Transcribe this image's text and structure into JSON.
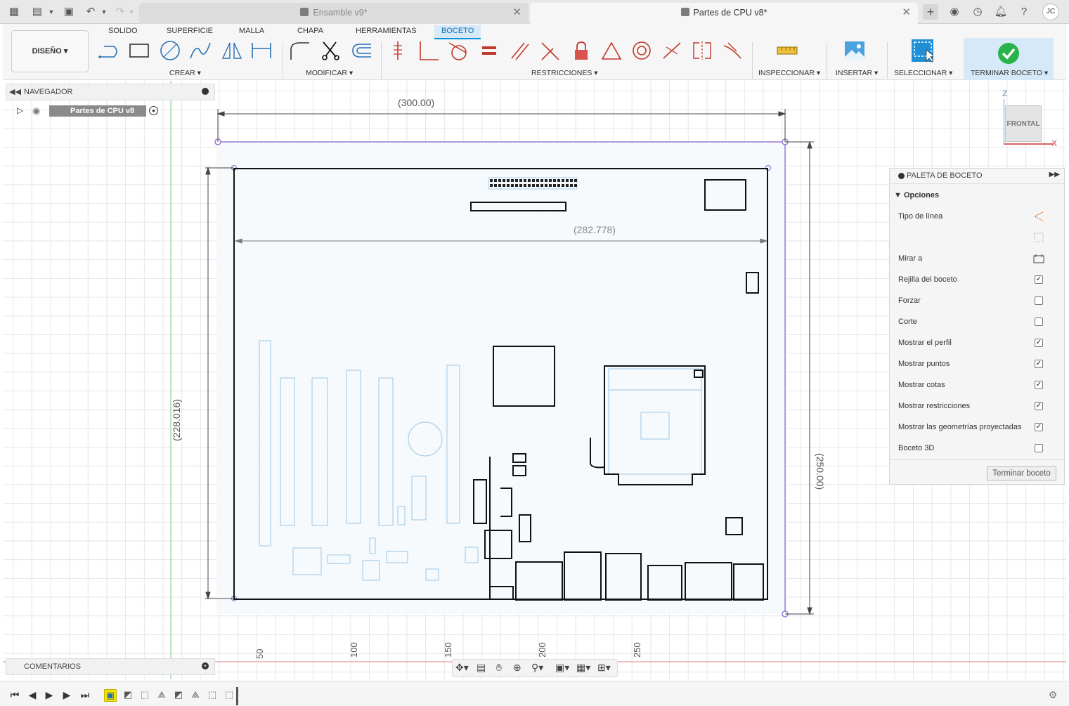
{
  "tabs": {
    "inactive": "Ensamble v9*",
    "active": "Partes de CPU v8*"
  },
  "user_initials": "JC",
  "ribbon": {
    "design": "DISEÑO ▾",
    "tabs": [
      "SOLIDO",
      "SUPERFICIE",
      "MALLA",
      "CHAPA",
      "HERRAMIENTAS",
      "BOCETO"
    ],
    "groups": {
      "crear": "CREAR ▾",
      "modificar": "MODIFICAR ▾",
      "restricciones": "RESTRICCIONES ▾",
      "inspeccionar": "INSPECCIONAR ▾",
      "insertar": "INSERTAR ▾",
      "seleccionar": "SELECCIONAR ▾",
      "terminar": "TERMINAR BOCETO ▾"
    }
  },
  "navigator": {
    "title": "NAVEGADOR",
    "root": "Partes de CPU v8"
  },
  "comments": "COMENTARIOS",
  "viewcube": {
    "face": "FRONTAL",
    "z": "Z",
    "x": "X"
  },
  "dimensions": {
    "top": "(300.00)",
    "inner": "(282.778)",
    "left": "(228.016)",
    "right": "(250.00)"
  },
  "ruler": [
    "50",
    "100",
    "150",
    "200",
    "250"
  ],
  "palette": {
    "title": "PALETA DE BOCETO",
    "section": "Opciones",
    "rows": [
      {
        "label": "Tipo de línea",
        "type": "icon"
      },
      {
        "label": "",
        "type": "icon"
      },
      {
        "label": "Mirar a",
        "type": "icon"
      },
      {
        "label": "Rejilla del boceto",
        "checked": true
      },
      {
        "label": "Forzar",
        "checked": false
      },
      {
        "label": "Corte",
        "checked": false
      },
      {
        "label": "Mostrar el perfil",
        "checked": true
      },
      {
        "label": "Mostrar puntos",
        "checked": true
      },
      {
        "label": "Mostrar cotas",
        "checked": true
      },
      {
        "label": "Mostrar restricciones",
        "checked": true
      },
      {
        "label": "Mostrar las geometrías proyectadas",
        "checked": true
      },
      {
        "label": "Boceto 3D",
        "checked": false
      }
    ],
    "finish_button": "Terminar boceto"
  },
  "colors": {
    "accent": "#0696d7",
    "sketch_line": "#111111",
    "projected": "#9ac7e6",
    "dimension_purple": "#9a7ad8",
    "finish_green": "#2ab34a"
  }
}
